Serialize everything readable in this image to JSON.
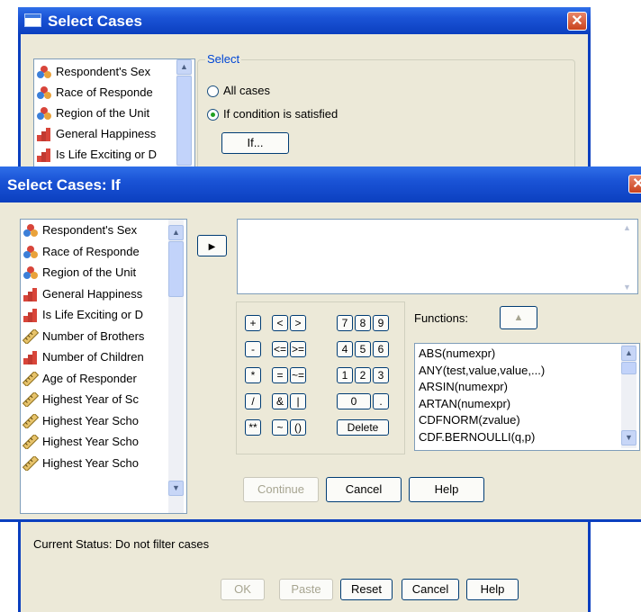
{
  "back_dialog": {
    "title": "Select Cases",
    "close": "✕",
    "variables": [
      {
        "label": "Respondent's Sex",
        "icon": "nominal-icon"
      },
      {
        "label": "Race of Responde",
        "icon": "nominal-icon"
      },
      {
        "label": "Region of the Unit",
        "icon": "nominal-icon"
      },
      {
        "label": "General Happiness",
        "icon": "ordinal-icon"
      },
      {
        "label": "Is Life Exciting or D",
        "icon": "ordinal-icon"
      }
    ],
    "select_group_label": "Select",
    "radio_all": "All cases",
    "radio_condition": "If condition is satisfied",
    "selected_radio": "If condition is satisfied",
    "if_button": "If...",
    "status": "Current Status: Do not filter cases",
    "buttons": {
      "ok": "OK",
      "paste": "Paste",
      "reset": "Reset",
      "cancel": "Cancel",
      "help": "Help"
    }
  },
  "if_dialog": {
    "title": "Select Cases: If",
    "close": "✕",
    "move_arrow": "▶",
    "variables": [
      {
        "label": "Respondent's Sex",
        "icon": "nominal-icon"
      },
      {
        "label": "Race of Responde",
        "icon": "nominal-icon"
      },
      {
        "label": "Region of the Unit",
        "icon": "nominal-icon"
      },
      {
        "label": "General Happiness",
        "icon": "ordinal-icon"
      },
      {
        "label": "Is Life Exciting or D",
        "icon": "ordinal-icon"
      },
      {
        "label": "Number of Brothers",
        "icon": "scale-icon"
      },
      {
        "label": "Number of Children",
        "icon": "ordinal-icon"
      },
      {
        "label": "Age of Responder",
        "icon": "scale-icon"
      },
      {
        "label": "Highest Year of Sc",
        "icon": "scale-icon"
      },
      {
        "label": "Highest Year Scho",
        "icon": "scale-icon"
      },
      {
        "label": "Highest Year Scho",
        "icon": "scale-icon"
      },
      {
        "label": "Highest Year Scho",
        "icon": "scale-icon"
      }
    ],
    "expression": "",
    "keypad": {
      "row1": [
        "+",
        "<",
        ">",
        "7",
        "8",
        "9"
      ],
      "row2": [
        "-",
        "<=",
        ">=",
        "4",
        "5",
        "6"
      ],
      "row3": [
        "*",
        "=",
        "~=",
        "1",
        "2",
        "3"
      ],
      "row4": [
        "/",
        "&",
        "|",
        "0",
        "."
      ],
      "row5": [
        "**",
        "~",
        "()",
        "Delete"
      ]
    },
    "functions_label": "Functions:",
    "functions": [
      "ABS(numexpr)",
      "ANY(test,value,value,...)",
      "ARSIN(numexpr)",
      "ARTAN(numexpr)",
      "CDFNORM(zvalue)",
      "CDF.BERNOULLI(q,p)"
    ],
    "buttons": {
      "continue": "Continue",
      "cancel": "Cancel",
      "help": "Help"
    }
  },
  "colors": {
    "title_blue": "#0b3fbf",
    "dialog_face": "#ece9d8",
    "close_red": "#c9421d",
    "selected_radio_green": "#21a121"
  }
}
